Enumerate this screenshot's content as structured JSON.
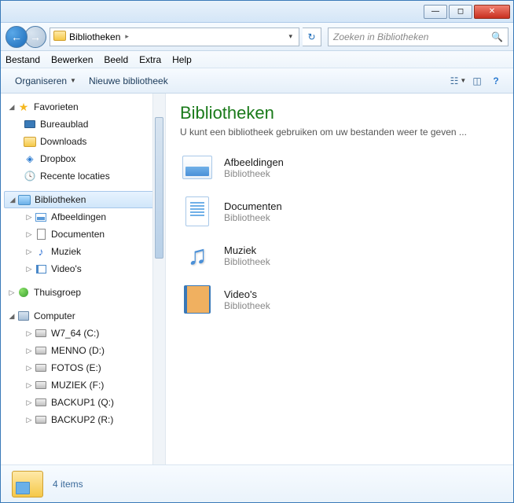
{
  "addressbar": {
    "path": "Bibliotheken",
    "chevron": "▸"
  },
  "search": {
    "placeholder": "Zoeken in Bibliotheken"
  },
  "menubar": [
    "Bestand",
    "Bewerken",
    "Beeld",
    "Extra",
    "Help"
  ],
  "toolbar": {
    "organize": "Organiseren",
    "new_library": "Nieuwe bibliotheek"
  },
  "sidebar": {
    "favorites": {
      "label": "Favorieten",
      "items": [
        "Bureaublad",
        "Downloads",
        "Dropbox",
        "Recente locaties"
      ]
    },
    "libraries": {
      "label": "Bibliotheken",
      "items": [
        "Afbeeldingen",
        "Documenten",
        "Muziek",
        "Video's"
      ]
    },
    "homegroup": {
      "label": "Thuisgroep"
    },
    "computer": {
      "label": "Computer",
      "drives": [
        "W7_64 (C:)",
        "MENNO (D:)",
        "FOTOS (E:)",
        "MUZIEK (F:)",
        "BACKUP1 (Q:)",
        "BACKUP2 (R:)"
      ]
    }
  },
  "content": {
    "title": "Bibliotheken",
    "subtitle": "U kunt een bibliotheek gebruiken om uw bestanden weer te geven ...",
    "item_sub": "Bibliotheek",
    "items": [
      {
        "name": "Afbeeldingen"
      },
      {
        "name": "Documenten"
      },
      {
        "name": "Muziek"
      },
      {
        "name": "Video's"
      }
    ]
  },
  "statusbar": {
    "label": "4 items"
  }
}
